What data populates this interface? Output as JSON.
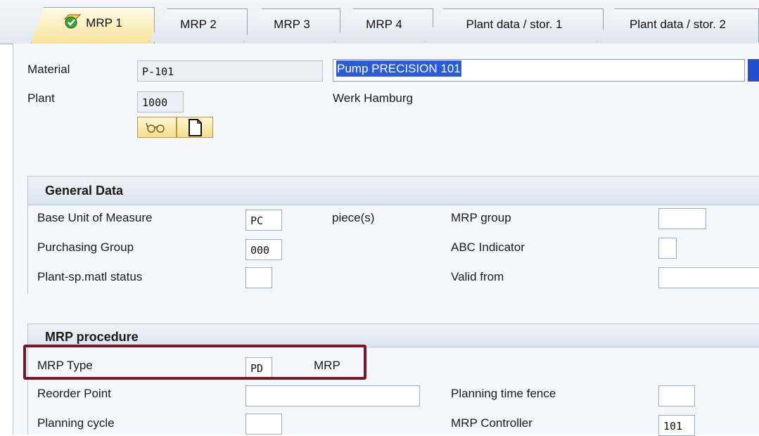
{
  "tabs": [
    {
      "label": "MRP 1",
      "active": true
    },
    {
      "label": "MRP 2",
      "active": false
    },
    {
      "label": "MRP 3",
      "active": false
    },
    {
      "label": "MRP 4",
      "active": false
    },
    {
      "label": "Plant data / stor. 1",
      "active": false
    },
    {
      "label": "Plant data / stor. 2",
      "active": false
    }
  ],
  "header": {
    "material_label": "Material",
    "material_value": "P-101",
    "material_desc": "Pump PRECISION 101",
    "plant_label": "Plant",
    "plant_value": "1000",
    "plant_desc": "Werk Hamburg",
    "icons": [
      "glasses-icon",
      "document-icon"
    ]
  },
  "general_data": {
    "title": "General Data",
    "base_uom_label": "Base Unit of Measure",
    "base_uom_value": "PC",
    "base_uom_text": "piece(s)",
    "mrp_group_label": "MRP group",
    "mrp_group_value": "",
    "purch_group_label": "Purchasing Group",
    "purch_group_value": "000",
    "abc_label": "ABC Indicator",
    "abc_value": "",
    "plant_status_label": "Plant-sp.matl status",
    "plant_status_value": "",
    "valid_from_label": "Valid from",
    "valid_from_value": ""
  },
  "mrp_procedure": {
    "title": "MRP procedure",
    "mrp_type_label": "MRP Type",
    "mrp_type_value": "PD",
    "mrp_type_text": "MRP",
    "reorder_label": "Reorder Point",
    "reorder_value": "",
    "ptf_label": "Planning time fence",
    "ptf_value": "",
    "cycle_label": "Planning cycle",
    "cycle_value": "",
    "controller_label": "MRP Controller",
    "controller_value": "101"
  },
  "colors": {
    "highlight_border": "#7a1525",
    "selection": "#2b5bd7",
    "active_tab": "#f7e39a"
  }
}
